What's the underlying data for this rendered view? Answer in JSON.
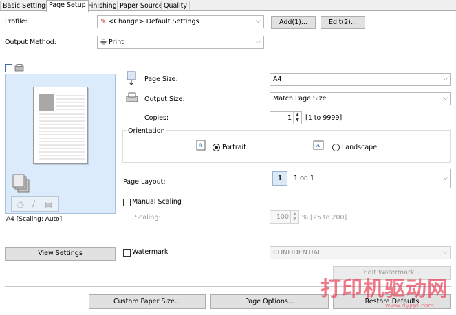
{
  "tabs": [
    {
      "label": "Basic Settings"
    },
    {
      "label": "Page Setup"
    },
    {
      "label": "Finishing"
    },
    {
      "label": "Paper Source"
    },
    {
      "label": "Quality"
    }
  ],
  "profile": {
    "label": "Profile:",
    "value": "<Change> Default Settings",
    "add_button": "Add(1)...",
    "edit_button": "Edit(2)..."
  },
  "output_method": {
    "label": "Output Method:",
    "value": "Print"
  },
  "preview": {
    "status": "A4 [Scaling: Auto]",
    "view_settings_button": "View Settings"
  },
  "page_size": {
    "label": "Page Size:",
    "value": "A4"
  },
  "output_size": {
    "label": "Output Size:",
    "value": "Match Page Size"
  },
  "copies": {
    "label": "Copies:",
    "value": "1",
    "range": "[1 to 9999]"
  },
  "orientation": {
    "label": "Orientation",
    "portrait": "Portrait",
    "landscape": "Landscape",
    "selected": "Portrait"
  },
  "page_layout": {
    "label": "Page Layout:",
    "value": "1 on 1",
    "icon_number": "1"
  },
  "manual_scaling": {
    "label": "Manual Scaling",
    "scaling_label": "Scaling:",
    "value": "100",
    "range": "% [25 to 200]"
  },
  "watermark": {
    "label": "Watermark",
    "value": "CONFIDENTIAL",
    "edit_button": "Edit Watermark..."
  },
  "footer": {
    "custom_paper_size": "Custom Paper Size...",
    "page_options": "Page Options...",
    "restore_defaults": "Restore Defaults"
  },
  "watermark_overlay": {
    "text": "打印机驱动网",
    "subtext": "www.dyjqd.com"
  },
  "colors": {
    "accent": "#e8455a",
    "preview_bg": "#dcebfb"
  }
}
